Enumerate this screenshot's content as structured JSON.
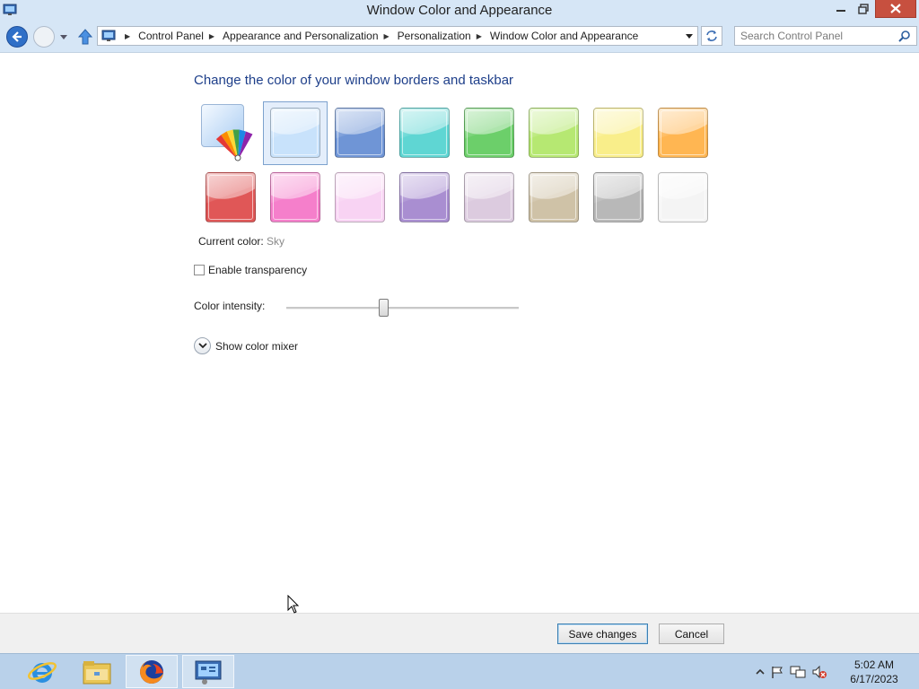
{
  "window": {
    "title": "Window Color and Appearance"
  },
  "nav": {
    "breadcrumbs": [
      "Control Panel",
      "Appearance and Personalization",
      "Personalization",
      "Window Color and Appearance"
    ],
    "search_placeholder": "Search Control Panel"
  },
  "content": {
    "heading": "Change the color of your window borders and taskbar",
    "current_color_label": "Current color:",
    "current_color_value": "Sky",
    "transparency_label": "Enable transparency",
    "transparency_checked": false,
    "intensity_label": "Color intensity:",
    "intensity_level": 0.42,
    "mixer_label": "Show color mixer",
    "selected_color": "Sky"
  },
  "swatches": [
    {
      "name": "Sky",
      "color": "#c8e2fb"
    },
    {
      "name": "Twilight",
      "color": "#6f95d6"
    },
    {
      "name": "Sea",
      "color": "#5fd6d3"
    },
    {
      "name": "Leaf",
      "color": "#6ccf6a"
    },
    {
      "name": "Lime",
      "color": "#b6e872"
    },
    {
      "name": "Sun",
      "color": "#f9ee8a"
    },
    {
      "name": "Pumpkin",
      "color": "#ffb652"
    },
    {
      "name": "Blush",
      "color": "#e05757"
    },
    {
      "name": "Violet",
      "color": "#f57fcb"
    },
    {
      "name": "Lavender",
      "color": "#f8d3f3"
    },
    {
      "name": "Taupe",
      "color": "#a98ed1"
    },
    {
      "name": "Chocolate",
      "color": "#dccbdf"
    },
    {
      "name": "Slate",
      "color": "#cfc2a7"
    },
    {
      "name": "Frost",
      "color": "#b8b8b8"
    },
    {
      "name": "White",
      "color": "#f4f4f4"
    }
  ],
  "buttons": {
    "save": "Save changes",
    "cancel": "Cancel"
  },
  "taskbar": {
    "time": "5:02 AM",
    "date": "6/17/2023",
    "apps": [
      "internet-explorer-icon",
      "file-explorer-icon",
      "firefox-icon",
      "control-panel-icon"
    ]
  },
  "colors": {
    "heading": "#1e3f8a",
    "titlebar": "#d6e6f6",
    "taskbar": "#b9d1ea",
    "close_button": "#c7503f"
  }
}
